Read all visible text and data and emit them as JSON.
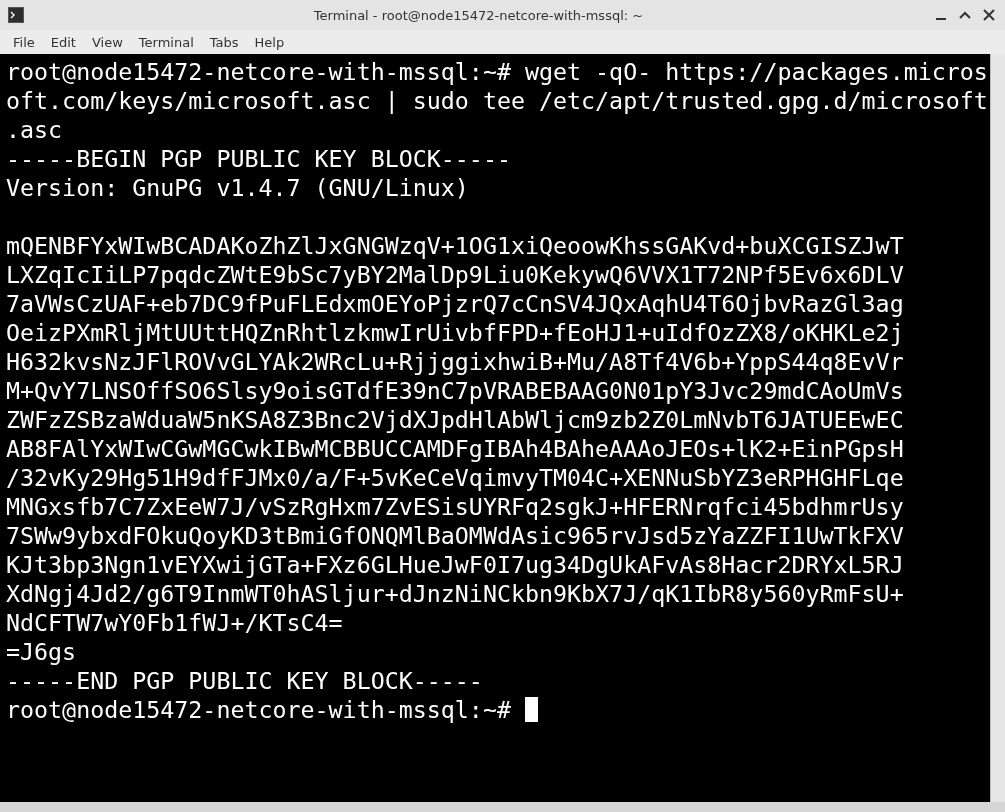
{
  "window": {
    "title": "Terminal - root@node15472-netcore-with-mssql: ~"
  },
  "menu": [
    "File",
    "Edit",
    "View",
    "Terminal",
    "Tabs",
    "Help"
  ],
  "terminal": {
    "command_lines": [
      "root@node15472-netcore-with-mssql:~# wget -qO- https://packages.micros",
      "oft.com/keys/microsoft.asc | sudo tee /etc/apt/trusted.gpg.d/microsoft",
      ".asc"
    ],
    "armor_header": [
      "-----BEGIN PGP PUBLIC KEY BLOCK-----",
      "Version: GnuPG v1.4.7 (GNU/Linux)"
    ],
    "key_body": [
      "mQENBFYxWIwBCADAKoZhZlJxGNGWzqV+1OG1xiQeoowKhssGAKvd+buXCGISZJwT",
      "LXZqIcIiLP7pqdcZWtE9bSc7yBY2MalDp9Liu0KekywQ6VVX1T72NPf5Ev6x6DLV",
      "7aVWsCzUAF+eb7DC9fPuFLEdxmOEYoPjzrQ7cCnSV4JQxAqhU4T6OjbvRazGl3ag",
      "OeizPXmRljMtUUttHQZnRhtlzkmwIrUivbfFPD+fEoHJ1+uIdfOzZX8/oKHKLe2j",
      "H632kvsNzJFlROVvGLYAk2WRcLu+RjjggixhwiB+Mu/A8Tf4V6b+YppS44q8EvVr",
      "M+QvY7LNSOffSO6Slsy9oisGTdfE39nC7pVRABEBAAG0N01pY3Jvc29mdCAoUmVs",
      "ZWFzZSBzaWduaW5nKSA8Z3Bnc2VjdXJpdHlAbWljcm9zb2Z0LmNvbT6JATUEEwEC",
      "AB8FAlYxWIwCGwMGCwkIBwMCBBUCCAMDFgIBAh4BAheAAAoJEOs+lK2+EinPGpsH",
      "/32vKy29Hg51H9dfFJMx0/a/F+5vKeCeVqimvyTM04C+XENNuSbYZ3eRPHGHFLqe",
      "MNGxsfb7C7ZxEeW7J/vSzRgHxm7ZvESisUYRFq2sgkJ+HFERNrqfci45bdhmrUsy",
      "7SWw9ybxdFOkuQoyKD3tBmiGfONQMlBaOMWdAsic965rvJsd5zYaZZFI1UwTkFXV",
      "KJt3bp3Ngn1vEYXwijGTa+FXz6GLHueJwF0I7ug34DgUkAFvAs8Hacr2DRYxL5RJ",
      "XdNgj4Jd2/g6T9InmWT0hASljur+dJnzNiNCkbn9KbX7J/qK1IbR8y560yRmFsU+",
      "NdCFTW7wY0Fb1fWJ+/KTsC4="
    ],
    "armor_footer": [
      "=J6gs",
      "-----END PGP PUBLIC KEY BLOCK-----"
    ],
    "prompt": "root@node15472-netcore-with-mssql:~#"
  }
}
